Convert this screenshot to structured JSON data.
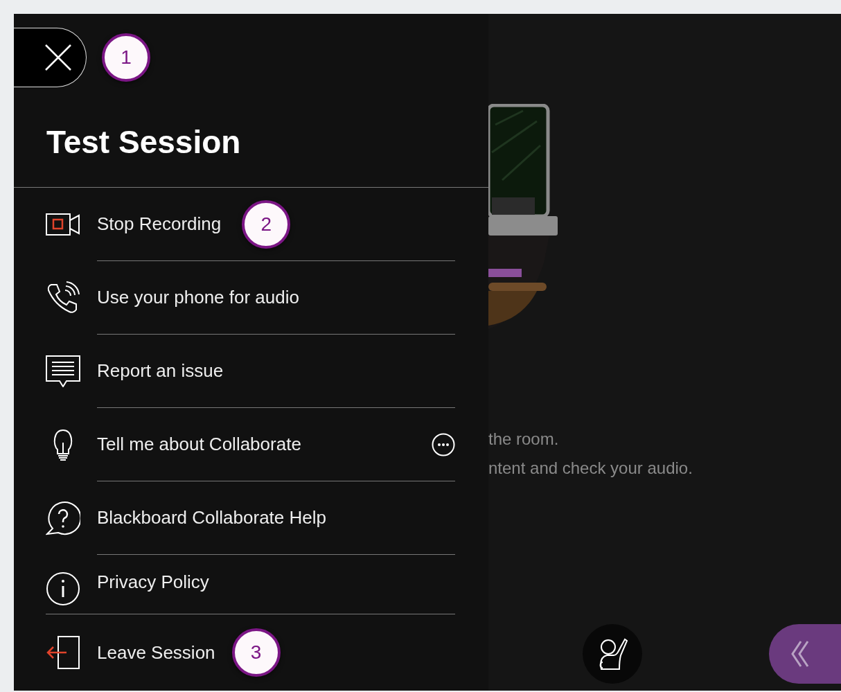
{
  "panel": {
    "close_badge": "1",
    "title": "Test Session",
    "menu_items": [
      {
        "kind": "recording",
        "label": "Stop Recording",
        "badge": "2",
        "more": false
      },
      {
        "kind": "phone",
        "label": "Use your phone for audio",
        "more": false
      },
      {
        "kind": "report",
        "label": "Report an issue",
        "more": false
      },
      {
        "kind": "tip",
        "label": "Tell me about Collaborate",
        "more": true
      },
      {
        "kind": "help",
        "label": "Blackboard Collaborate Help",
        "more": false
      },
      {
        "kind": "info",
        "label": "Privacy Policy",
        "more": false
      }
    ],
    "leave": {
      "label": "Leave Session",
      "badge": "3"
    }
  },
  "stage": {
    "message_lines": [
      "the room.",
      "ntent and check your audio."
    ]
  }
}
